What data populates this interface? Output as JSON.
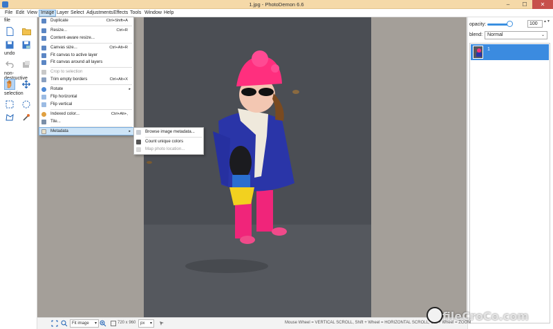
{
  "window": {
    "title": "1.jpg  -  PhotoDemon 6.6",
    "minimize_glyph": "–",
    "maximize_glyph": "☐",
    "close_glyph": "✕"
  },
  "menubar": {
    "items": [
      "File",
      "Edit",
      "View",
      "Image",
      "Layer",
      "Select",
      "Adjustments",
      "Effects",
      "Tools",
      "Window",
      "Help"
    ],
    "active": "Image"
  },
  "toolbox": {
    "sections": {
      "file": "file",
      "undo": "undo",
      "nondestructive": "non-destructive",
      "selection": "selection"
    },
    "icons": [
      "new-file-icon",
      "open-folder-icon",
      "save-icon",
      "save-as-icon",
      "undo-icon",
      "redo-icon",
      "hand-icon",
      "move-icon",
      "rect-select-icon",
      "ellipse-select-icon",
      "lasso-select-icon",
      "wand-select-icon"
    ]
  },
  "image_menu": {
    "items": [
      {
        "label": "Duplicate",
        "shortcut": "Ctrl+Shift+A",
        "icon": "duplicate-icon",
        "color": "#5b86c4"
      },
      {
        "sep": true
      },
      {
        "label": "Resize...",
        "shortcut": "Ctrl+R",
        "icon": "resize-icon",
        "color": "#5b86c4"
      },
      {
        "label": "Content-aware resize...",
        "shortcut": "",
        "icon": "content-aware-icon",
        "color": "#5b86c4"
      },
      {
        "sep": true
      },
      {
        "label": "Canvas size...",
        "shortcut": "Ctrl+Alt+R",
        "icon": "canvas-size-icon",
        "color": "#5b86c4"
      },
      {
        "label": "Fit canvas to active layer",
        "shortcut": "",
        "icon": "fit-layer-icon",
        "color": "#5b86c4"
      },
      {
        "label": "Fit canvas around all layers",
        "shortcut": "",
        "icon": "fit-all-icon",
        "color": "#5b86c4"
      },
      {
        "sep": true
      },
      {
        "label": "Crop to selection",
        "shortcut": "",
        "icon": "crop-icon",
        "color": "#c8c8c8",
        "disabled": true
      },
      {
        "label": "Trim empty borders",
        "shortcut": "Ctrl+Alt+X",
        "icon": "trim-icon",
        "color": "#8aa0c0"
      },
      {
        "sep": true
      },
      {
        "label": "Rotate",
        "shortcut": "",
        "icon": "rotate-icon",
        "color": "#4f8ad6",
        "submenu": true
      },
      {
        "label": "Flip horizontal",
        "shortcut": "",
        "icon": "flip-horizontal-icon",
        "color": "#9bbbe3"
      },
      {
        "label": "Flip vertical",
        "shortcut": "",
        "icon": "flip-vertical-icon",
        "color": "#9bbbe3"
      },
      {
        "sep": true
      },
      {
        "label": "Indexed color...",
        "shortcut": "Ctrl+Alt+,",
        "icon": "indexed-color-icon",
        "color": "#e0a040"
      },
      {
        "label": "Tile...",
        "shortcut": "",
        "icon": "tile-icon",
        "color": "#7a8fa8"
      },
      {
        "sep": true
      },
      {
        "label": "Metadata",
        "shortcut": "",
        "icon": "metadata-icon",
        "color": "#e8e0c8",
        "submenu": true,
        "highlight": true
      }
    ],
    "submenu_arrow": "▸"
  },
  "metadata_submenu": {
    "items": [
      {
        "label": "Browse image metadata...",
        "icon": "browse-metadata-icon",
        "color": "#c9cdd3"
      },
      {
        "sep": true
      },
      {
        "label": "Count unique colors",
        "icon": "count-colors-icon",
        "color": "#555"
      },
      {
        "label": "Map photo location...",
        "icon": "map-location-icon",
        "color": "#d8d8d8",
        "disabled": true
      }
    ]
  },
  "right_panel": {
    "opacity_label": "opacity:",
    "opacity_value": "100",
    "opacity_fraction": 1.0,
    "spin_arrows": "▲▼",
    "blend_label": "blend:",
    "blend_value": "Normal",
    "dropdown_arrow": "⌄",
    "layers": [
      {
        "name": "1",
        "selected": true
      }
    ]
  },
  "statusbar": {
    "zoom_mode": "Fit image",
    "dropdown_arrow": "▾",
    "dimensions": "720 x 960",
    "unit": "px",
    "hint": "Mouse Wheel = VERTICAL SCROLL,  Shift + Wheel = HORIZONTAL SCROLL,  Ctrl + Wheel = ZOOM"
  },
  "watermark": "fileCroCo.com",
  "colors": {
    "title_bar": "#f5d9a8",
    "accent": "#3b8be0",
    "menu_highlight": "#cde4f7",
    "canvas_bg": "#a49f99",
    "close_button": "#c7504b"
  }
}
